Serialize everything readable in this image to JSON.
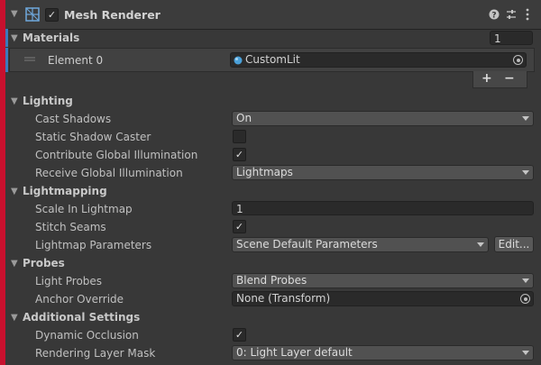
{
  "header": {
    "title": "Mesh Renderer",
    "enabled_check": "✓",
    "icons": [
      "mesh-renderer-icon",
      "help-icon",
      "presets-icon",
      "menu-icon"
    ]
  },
  "materials": {
    "title": "Materials",
    "count": "1",
    "element_label": "Element 0",
    "element_value": "CustomLit",
    "add_label": "+",
    "remove_label": "−"
  },
  "lighting": {
    "title": "Lighting",
    "cast_shadows_label": "Cast Shadows",
    "cast_shadows_value": "On",
    "static_shadow_label": "Static Shadow Caster",
    "static_shadow_checked": false,
    "contribute_gi_label": "Contribute Global Illumination",
    "contribute_gi_check": "✓",
    "receive_gi_label": "Receive Global Illumination",
    "receive_gi_value": "Lightmaps"
  },
  "lightmapping": {
    "title": "Lightmapping",
    "scale_label": "Scale In Lightmap",
    "scale_value": "1",
    "stitch_label": "Stitch Seams",
    "stitch_check": "✓",
    "params_label": "Lightmap Parameters",
    "params_value": "Scene Default Parameters",
    "edit_label": "Edit..."
  },
  "probes": {
    "title": "Probes",
    "light_probes_label": "Light Probes",
    "light_probes_value": "Blend Probes",
    "anchor_label": "Anchor Override",
    "anchor_value": "None (Transform)"
  },
  "additional": {
    "title": "Additional Settings",
    "dynamic_occlusion_label": "Dynamic Occlusion",
    "dynamic_occlusion_check": "✓",
    "rendering_layer_label": "Rendering Layer Mask",
    "rendering_layer_value": "0: Light Layer default"
  },
  "colors": {
    "background": "#383838",
    "accent_red": "#c8102e",
    "selection_blue": "#3a79bb"
  }
}
